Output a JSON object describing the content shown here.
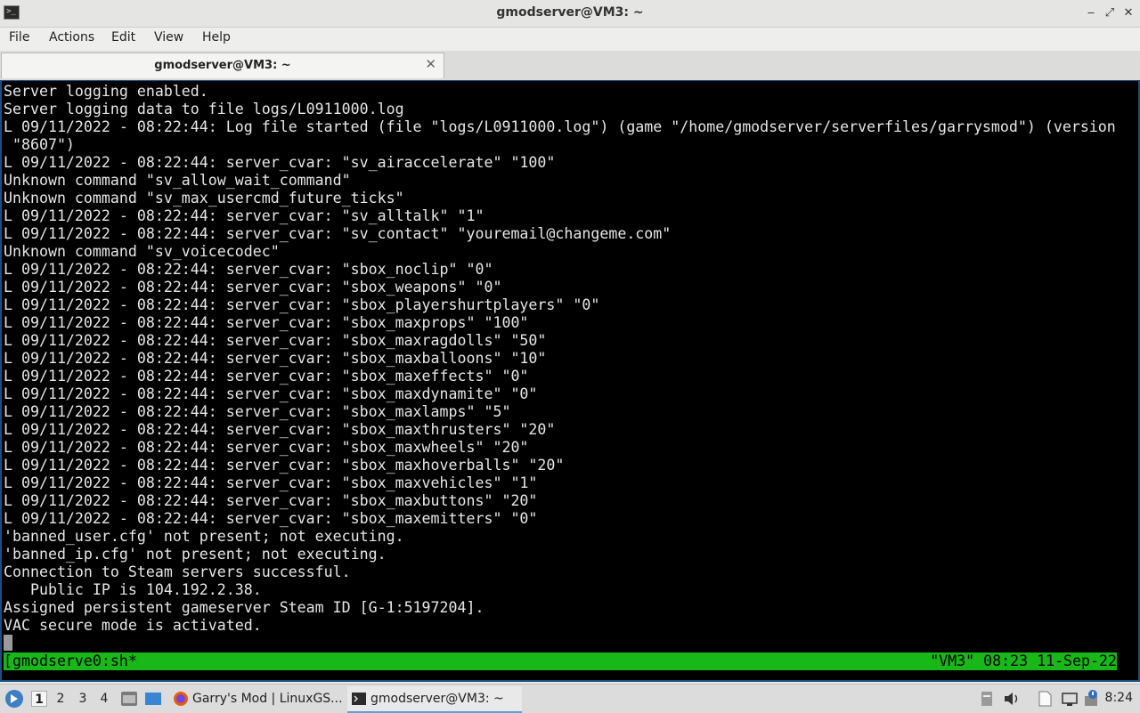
{
  "window": {
    "title": "gmodserver@VM3: ~",
    "app_icon": "terminal-icon",
    "app_icon_glyph": ">_",
    "controls": {
      "minimize": "‒",
      "restore": "⤢",
      "close": "✕"
    }
  },
  "menubar": {
    "items": [
      "File",
      "Actions",
      "Edit",
      "View",
      "Help"
    ]
  },
  "tab": {
    "label": "gmodserver@VM3: ~",
    "close_glyph": "✕"
  },
  "terminal": {
    "lines": [
      "Server logging enabled.",
      "Server logging data to file logs/L0911000.log",
      "L 09/11/2022 - 08:22:44: Log file started (file \"logs/L0911000.log\") (game \"/home/gmodserver/serverfiles/garrysmod\") (version",
      " \"8607\")",
      "L 09/11/2022 - 08:22:44: server_cvar: \"sv_airaccelerate\" \"100\"",
      "Unknown command \"sv_allow_wait_command\"",
      "Unknown command \"sv_max_usercmd_future_ticks\"",
      "L 09/11/2022 - 08:22:44: server_cvar: \"sv_alltalk\" \"1\"",
      "L 09/11/2022 - 08:22:44: server_cvar: \"sv_contact\" \"youremail@changeme.com\"",
      "Unknown command \"sv_voicecodec\"",
      "L 09/11/2022 - 08:22:44: server_cvar: \"sbox_noclip\" \"0\"",
      "L 09/11/2022 - 08:22:44: server_cvar: \"sbox_weapons\" \"0\"",
      "L 09/11/2022 - 08:22:44: server_cvar: \"sbox_playershurtplayers\" \"0\"",
      "L 09/11/2022 - 08:22:44: server_cvar: \"sbox_maxprops\" \"100\"",
      "L 09/11/2022 - 08:22:44: server_cvar: \"sbox_maxragdolls\" \"50\"",
      "L 09/11/2022 - 08:22:44: server_cvar: \"sbox_maxballoons\" \"10\"",
      "L 09/11/2022 - 08:22:44: server_cvar: \"sbox_maxeffects\" \"0\"",
      "L 09/11/2022 - 08:22:44: server_cvar: \"sbox_maxdynamite\" \"0\"",
      "L 09/11/2022 - 08:22:44: server_cvar: \"sbox_maxlamps\" \"5\"",
      "L 09/11/2022 - 08:22:44: server_cvar: \"sbox_maxthrusters\" \"20\"",
      "L 09/11/2022 - 08:22:44: server_cvar: \"sbox_maxwheels\" \"20\"",
      "L 09/11/2022 - 08:22:44: server_cvar: \"sbox_maxhoverballs\" \"20\"",
      "L 09/11/2022 - 08:22:44: server_cvar: \"sbox_maxvehicles\" \"1\"",
      "L 09/11/2022 - 08:22:44: server_cvar: \"sbox_maxbuttons\" \"20\"",
      "L 09/11/2022 - 08:22:44: server_cvar: \"sbox_maxemitters\" \"0\"",
      "'banned_user.cfg' not present; not executing.",
      "'banned_ip.cfg' not present; not executing.",
      "Connection to Steam servers successful.",
      "   Public IP is 104.192.2.38.",
      "Assigned persistent gameserver Steam ID [G-1:5197204].",
      "VAC secure mode is activated."
    ],
    "status_left": "[gmodserve0:sh*",
    "status_right": "\"VM3\" 08:23 11-Sep-22",
    "status_color": "#18b818"
  },
  "taskbar": {
    "start_icon": "lxqt-menu-icon",
    "workspaces": [
      "1",
      "2",
      "3",
      "4"
    ],
    "active_workspace": "1",
    "quicklaunch": [
      "file-manager-icon",
      "show-desktop-icon"
    ],
    "tasks": [
      {
        "icon": "firefox-icon",
        "label": "Garry's Mod | LinuxGS...",
        "active": false
      },
      {
        "icon": "terminal-icon",
        "label": "gmodserver@VM3: ~",
        "active": true
      }
    ],
    "tray": [
      "clipboard-icon",
      "volume-icon",
      "notes-icon",
      "network-icon",
      "update-notifier-icon"
    ],
    "clock": "8:24"
  }
}
